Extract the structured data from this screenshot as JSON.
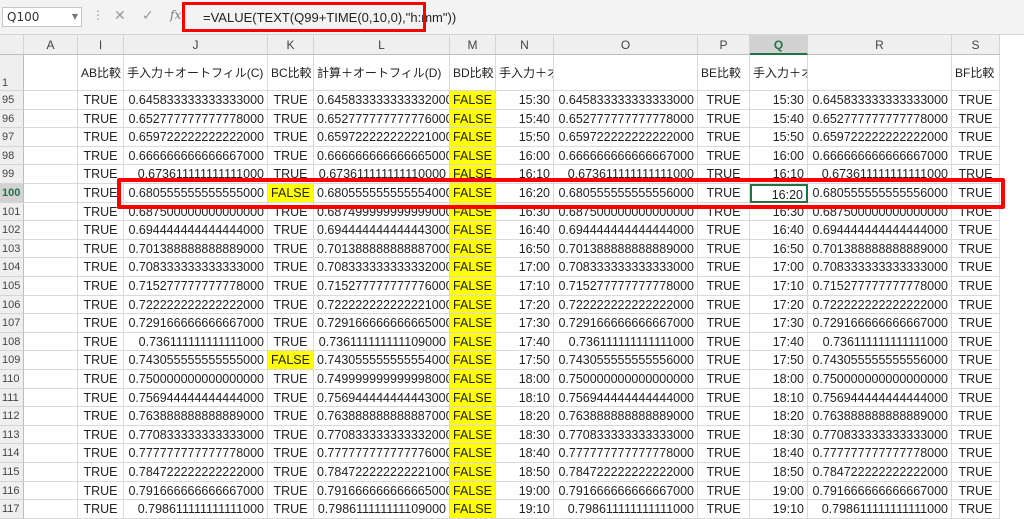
{
  "formula_bar": {
    "name_box": "Q100",
    "dots": "⋮",
    "cancel_glyph": "✕",
    "enter_glyph": "✓",
    "fx_label": "fx",
    "formula": "=VALUE(TEXT(Q99+TIME(0,10,0),\"h:mm\"))"
  },
  "columns": [
    "A",
    "I",
    "J",
    "K",
    "L",
    "M",
    "N",
    "O",
    "P",
    "Q",
    "R",
    "S"
  ],
  "selected_column": "Q",
  "header_row": {
    "row_number": "1",
    "labels": {
      "I": "AB比較",
      "J": "手入力＋オートフィル(C)",
      "K": "BC比較",
      "L": "計算＋オートフィル(D)",
      "M": "BD比較",
      "N": "手入力＋オートフィル+value&text€",
      "O": "",
      "P": "BE比較",
      "Q": "手入力＋オートフィル+value&text(E)",
      "R": "",
      "S": "BF比較"
    }
  },
  "selected_row": "100",
  "rows": [
    {
      "n": "95",
      "I": "TRUE",
      "J": "0.645833333333333000",
      "K": "TRUE",
      "L": "0.645833333333332000",
      "M": "FALSE",
      "N": "15:30",
      "O": "0.645833333333333000",
      "P": "TRUE",
      "Q": "15:30",
      "R": "0.645833333333333000",
      "S": "TRUE"
    },
    {
      "n": "96",
      "I": "TRUE",
      "J": "0.652777777777778000",
      "K": "TRUE",
      "L": "0.652777777777776000",
      "M": "FALSE",
      "N": "15:40",
      "O": "0.652777777777778000",
      "P": "TRUE",
      "Q": "15:40",
      "R": "0.652777777777778000",
      "S": "TRUE"
    },
    {
      "n": "97",
      "I": "TRUE",
      "J": "0.659722222222222000",
      "K": "TRUE",
      "L": "0.659722222222221000",
      "M": "FALSE",
      "N": "15:50",
      "O": "0.659722222222222000",
      "P": "TRUE",
      "Q": "15:50",
      "R": "0.659722222222222000",
      "S": "TRUE"
    },
    {
      "n": "98",
      "I": "TRUE",
      "J": "0.666666666666667000",
      "K": "TRUE",
      "L": "0.666666666666665000",
      "M": "FALSE",
      "N": "16:00",
      "O": "0.666666666666667000",
      "P": "TRUE",
      "Q": "16:00",
      "R": "0.666666666666667000",
      "S": "TRUE"
    },
    {
      "n": "99",
      "I": "TRUE",
      "J": "0.673611111111111000",
      "K": "TRUE",
      "L": "0.673611111111110000",
      "M": "FALSE",
      "N": "16:10",
      "O": "0.673611111111111000",
      "P": "TRUE",
      "Q": "16:10",
      "R": "0.673611111111111000",
      "S": "TRUE"
    },
    {
      "n": "100",
      "I": "TRUE",
      "J": "0.680555555555555000",
      "K": "FALSE",
      "L": "0.680555555555554000",
      "M": "FALSE",
      "N": "16:20",
      "O": "0.680555555555556000",
      "P": "TRUE",
      "Q": "16:20",
      "R": "0.680555555555556000",
      "S": "TRUE"
    },
    {
      "n": "101",
      "I": "TRUE",
      "J": "0.687500000000000000",
      "K": "TRUE",
      "L": "0.687499999999999000",
      "M": "FALSE",
      "N": "16:30",
      "O": "0.687500000000000000",
      "P": "TRUE",
      "Q": "16:30",
      "R": "0.687500000000000000",
      "S": "TRUE"
    },
    {
      "n": "102",
      "I": "TRUE",
      "J": "0.694444444444444000",
      "K": "TRUE",
      "L": "0.694444444444443000",
      "M": "FALSE",
      "N": "16:40",
      "O": "0.694444444444444000",
      "P": "TRUE",
      "Q": "16:40",
      "R": "0.694444444444444000",
      "S": "TRUE"
    },
    {
      "n": "103",
      "I": "TRUE",
      "J": "0.701388888888889000",
      "K": "TRUE",
      "L": "0.701388888888887000",
      "M": "FALSE",
      "N": "16:50",
      "O": "0.701388888888889000",
      "P": "TRUE",
      "Q": "16:50",
      "R": "0.701388888888889000",
      "S": "TRUE"
    },
    {
      "n": "104",
      "I": "TRUE",
      "J": "0.708333333333333000",
      "K": "TRUE",
      "L": "0.708333333333332000",
      "M": "FALSE",
      "N": "17:00",
      "O": "0.708333333333333000",
      "P": "TRUE",
      "Q": "17:00",
      "R": "0.708333333333333000",
      "S": "TRUE"
    },
    {
      "n": "105",
      "I": "TRUE",
      "J": "0.715277777777778000",
      "K": "TRUE",
      "L": "0.715277777777776000",
      "M": "FALSE",
      "N": "17:10",
      "O": "0.715277777777778000",
      "P": "TRUE",
      "Q": "17:10",
      "R": "0.715277777777778000",
      "S": "TRUE"
    },
    {
      "n": "106",
      "I": "TRUE",
      "J": "0.722222222222222000",
      "K": "TRUE",
      "L": "0.722222222222221000",
      "M": "FALSE",
      "N": "17:20",
      "O": "0.722222222222222000",
      "P": "TRUE",
      "Q": "17:20",
      "R": "0.722222222222222000",
      "S": "TRUE"
    },
    {
      "n": "107",
      "I": "TRUE",
      "J": "0.729166666666667000",
      "K": "TRUE",
      "L": "0.729166666666665000",
      "M": "FALSE",
      "N": "17:30",
      "O": "0.729166666666667000",
      "P": "TRUE",
      "Q": "17:30",
      "R": "0.729166666666667000",
      "S": "TRUE"
    },
    {
      "n": "108",
      "I": "TRUE",
      "J": "0.736111111111111000",
      "K": "TRUE",
      "L": "0.736111111111109000",
      "M": "FALSE",
      "N": "17:40",
      "O": "0.736111111111111000",
      "P": "TRUE",
      "Q": "17:40",
      "R": "0.736111111111111000",
      "S": "TRUE"
    },
    {
      "n": "109",
      "I": "TRUE",
      "J": "0.743055555555555000",
      "K": "FALSE",
      "L": "0.743055555555554000",
      "M": "FALSE",
      "N": "17:50",
      "O": "0.743055555555556000",
      "P": "TRUE",
      "Q": "17:50",
      "R": "0.743055555555556000",
      "S": "TRUE"
    },
    {
      "n": "110",
      "I": "TRUE",
      "J": "0.750000000000000000",
      "K": "TRUE",
      "L": "0.749999999999998000",
      "M": "FALSE",
      "N": "18:00",
      "O": "0.750000000000000000",
      "P": "TRUE",
      "Q": "18:00",
      "R": "0.750000000000000000",
      "S": "TRUE"
    },
    {
      "n": "111",
      "I": "TRUE",
      "J": "0.756944444444444000",
      "K": "TRUE",
      "L": "0.756944444444443000",
      "M": "FALSE",
      "N": "18:10",
      "O": "0.756944444444444000",
      "P": "TRUE",
      "Q": "18:10",
      "R": "0.756944444444444000",
      "S": "TRUE"
    },
    {
      "n": "112",
      "I": "TRUE",
      "J": "0.763888888888889000",
      "K": "TRUE",
      "L": "0.763888888888887000",
      "M": "FALSE",
      "N": "18:20",
      "O": "0.763888888888889000",
      "P": "TRUE",
      "Q": "18:20",
      "R": "0.763888888888889000",
      "S": "TRUE"
    },
    {
      "n": "113",
      "I": "TRUE",
      "J": "0.770833333333333000",
      "K": "TRUE",
      "L": "0.770833333333332000",
      "M": "FALSE",
      "N": "18:30",
      "O": "0.770833333333333000",
      "P": "TRUE",
      "Q": "18:30",
      "R": "0.770833333333333000",
      "S": "TRUE"
    },
    {
      "n": "114",
      "I": "TRUE",
      "J": "0.777777777777778000",
      "K": "TRUE",
      "L": "0.777777777777776000",
      "M": "FALSE",
      "N": "18:40",
      "O": "0.777777777777778000",
      "P": "TRUE",
      "Q": "18:40",
      "R": "0.777777777777778000",
      "S": "TRUE"
    },
    {
      "n": "115",
      "I": "TRUE",
      "J": "0.784722222222222000",
      "K": "TRUE",
      "L": "0.784722222222221000",
      "M": "FALSE",
      "N": "18:50",
      "O": "0.784722222222222000",
      "P": "TRUE",
      "Q": "18:50",
      "R": "0.784722222222222000",
      "S": "TRUE"
    },
    {
      "n": "116",
      "I": "TRUE",
      "J": "0.791666666666667000",
      "K": "TRUE",
      "L": "0.791666666666665000",
      "M": "FALSE",
      "N": "19:00",
      "O": "0.791666666666667000",
      "P": "TRUE",
      "Q": "19:00",
      "R": "0.791666666666667000",
      "S": "TRUE"
    },
    {
      "n": "117",
      "I": "TRUE",
      "J": "0.798611111111111000",
      "K": "TRUE",
      "L": "0.798611111111109000",
      "M": "FALSE",
      "N": "19:10",
      "O": "0.798611111111111000",
      "P": "TRUE",
      "Q": "19:10",
      "R": "0.798611111111111000",
      "S": "TRUE"
    }
  ],
  "colors": {
    "highlight_yellow": "#ffff00",
    "annotation_red": "#ff0000",
    "excel_green": "#217346"
  }
}
